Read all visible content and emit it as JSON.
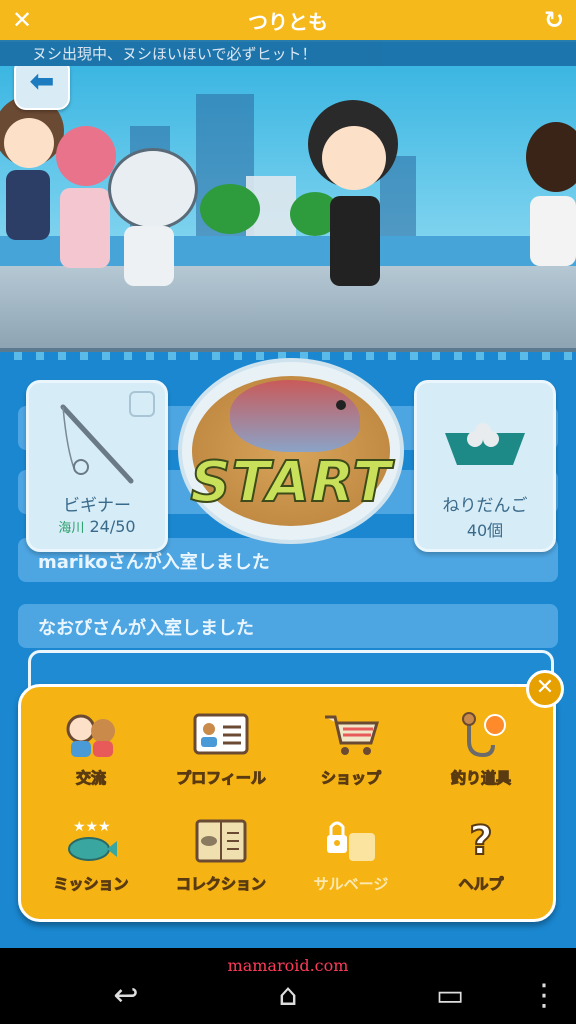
{
  "titlebar": {
    "title": "つりとも",
    "close_icon": "close-icon",
    "refresh_icon": "refresh-icon"
  },
  "ticker": {
    "text": "ヌシ出現中、ヌシほいほいで必ずヒット！"
  },
  "scene": {
    "back_icon": "back-arrow-icon"
  },
  "cards": {
    "rod": {
      "name": "ビギナー",
      "location": "海川",
      "count": "24/50",
      "icon": "fishing-rod-icon"
    },
    "bait": {
      "name": "ねりだんご",
      "count": "40個",
      "icon": "bait-boat-icon"
    }
  },
  "start": {
    "label": "START"
  },
  "chat": [
    {
      "text": "marikoさんが入室しました"
    },
    {
      "text": "なおぴさんが入室しました"
    }
  ],
  "menu": {
    "items": [
      {
        "label": "交流",
        "icon": "friends-icon"
      },
      {
        "label": "プロフィール",
        "icon": "profile-card-icon"
      },
      {
        "label": "ショップ",
        "icon": "shopping-cart-icon"
      },
      {
        "label": "釣り道具",
        "icon": "fishing-gear-icon"
      },
      {
        "label": "ミッション",
        "icon": "mission-fish-icon"
      },
      {
        "label": "コレクション",
        "icon": "collection-book-icon"
      },
      {
        "label": "サルベージ",
        "icon": "locked-salvage-icon"
      },
      {
        "label": "ヘルプ",
        "icon": "help-icon"
      }
    ]
  },
  "navbar": {
    "watermark": "mamaroid.com"
  },
  "colors": {
    "header": "#f6b91c",
    "sea": "#1a87d0",
    "menu": "#f5b414"
  }
}
